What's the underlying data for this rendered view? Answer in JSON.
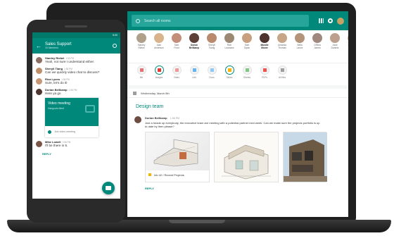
{
  "laptop": {
    "search": {
      "placeholder": "Search all rooms"
    },
    "people": [
      {
        "name": "Stanley\nRiebel",
        "color": "#b0a08a",
        "bold": false
      },
      {
        "name": "Alan\nAnderson",
        "color": "#d9b38c",
        "bold": false
      },
      {
        "name": "Sam\nFrost",
        "color": "#c48f7a",
        "bold": false
      },
      {
        "name": "Dorian\nBellkamp",
        "color": "#5d4037",
        "bold": true
      },
      {
        "name": "Sheryll\nTsang",
        "color": "#b98a6e",
        "bold": false
      },
      {
        "name": "Rich\nLearcase",
        "color": "#9c8873",
        "bold": false
      },
      {
        "name": "Sam\nTaylor",
        "color": "#c9a07f",
        "bold": false
      },
      {
        "name": "Mandie\nMoore",
        "color": "#4e342e",
        "bold": true
      },
      {
        "name": "Amanda\nThomas",
        "color": "#c7a687",
        "bold": false
      },
      {
        "name": "Bella\nLance",
        "color": "#b3937a",
        "bold": false
      },
      {
        "name": "O'Blea\nJames",
        "color": "#a1887f",
        "bold": false
      },
      {
        "name": "Joice\nDaniels",
        "color": "#bca08d",
        "bold": false
      },
      {
        "name": "Bridgette\nJones",
        "color": "#d1b19a",
        "bold": false
      }
    ],
    "room_types": [
      {
        "label": "Me",
        "color": "#e57373",
        "selected": false
      },
      {
        "label": "Images",
        "color": "#e53935",
        "selected": true
      },
      {
        "label": "Video",
        "color": "#ef9a9a",
        "selected": false
      },
      {
        "label": "Link",
        "color": "#64b5f6",
        "selected": false
      },
      {
        "label": "Docs",
        "color": "#90caf9",
        "selected": false
      },
      {
        "label": "Slides",
        "color": "#ffb300",
        "selected": true
      },
      {
        "label": "Sheets",
        "color": "#81c784",
        "selected": false
      },
      {
        "label": "PDFs",
        "color": "#ef5350",
        "selected": false
      },
      {
        "label": "All files",
        "color": "#9e9e9e",
        "selected": false
      }
    ],
    "date": "Wednesday, March 8th",
    "section_title": "Design team",
    "post": {
      "author": "Dorian Bellkamp",
      "time": "1:56 PM",
      "text": "Just a heads up everybody, the executive team are meeting with a potential partner next week. Can we make sure the projects portfolio is up to date by then please?"
    },
    "attachment_caption": "Inb 42 / Recent Projects",
    "reply_label": "REPLY"
  },
  "phone": {
    "status_time": "5:00",
    "title": "Sales Support",
    "subtitle": "15 Members",
    "messages": [
      {
        "name": "Stanley Riebel",
        "time": "1:55 PM",
        "text": "Yeah, not sure I understand either.",
        "color": "#8d6e63"
      },
      {
        "name": "Sheryll Tiang",
        "time": "1:56 PM",
        "text": "Can we quickly video chat to discuss?",
        "color": "#bf8f6a"
      },
      {
        "name": "Rica Lyons",
        "time": "1:56 PM",
        "text": "Sure, let's do it!",
        "color": "#c69676"
      },
      {
        "name": "Dorian Bellkamp",
        "time": "1:56 PM",
        "text": "Here ya go",
        "color": "#4e342e"
      }
    ],
    "video": {
      "title": "Video meeting",
      "subtitle": "Hangouts Meet",
      "join": "Join video meeting"
    },
    "last_message": {
      "name": "Mike Lowell",
      "time": "1:56 PM",
      "text": "I'll be there in 5.",
      "color": "#795548"
    },
    "reply_label": "REPLY"
  }
}
